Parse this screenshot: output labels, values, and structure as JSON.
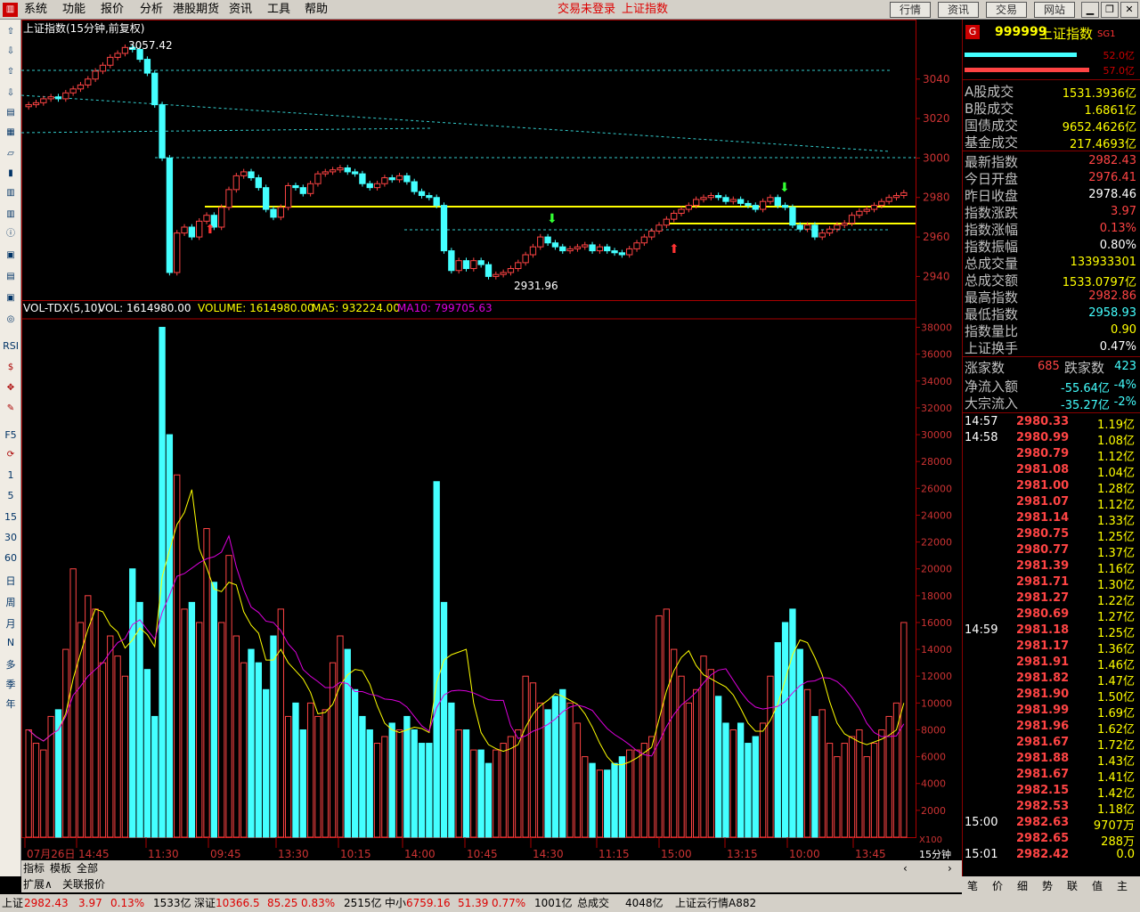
{
  "menubar": {
    "items": [
      "系统",
      "功能",
      "报价",
      "分析",
      "港股期货",
      "资讯",
      "工具",
      "帮助"
    ],
    "center1": "交易未登录",
    "center2": "上证指数",
    "buttons": [
      "行情",
      "资讯",
      "交易",
      "网站"
    ]
  },
  "chart": {
    "title": "上证指数(15分钟,前复权)",
    "high_label": "3057.42",
    "low_label": "2931.96",
    "vol_header": {
      "name": "VOL-TDX(5,10)",
      "vol": "VOL: 1614980.00",
      "volume": "VOLUME: 1614980.00",
      "ma5": "MA5: 932224.00",
      "ma10": "MA10: 799705.63"
    },
    "price_ticks": [
      "3040",
      "3020",
      "3000",
      "2980",
      "2960",
      "2940"
    ],
    "vol_ticks": [
      "38000",
      "36000",
      "34000",
      "32000",
      "30000",
      "28000",
      "26000",
      "24000",
      "22000",
      "20000",
      "18000",
      "16000",
      "14000",
      "12000",
      "10000",
      "8000",
      "6000",
      "4000",
      "2000"
    ],
    "time_ticks": [
      "07月26日",
      "14:45",
      "11:30",
      "09:45",
      "13:30",
      "10:15",
      "14:00",
      "10:45",
      "14:30",
      "11:15",
      "15:00",
      "13:15",
      "10:00",
      "13:45"
    ],
    "x100": "X100",
    "period": "15分钟"
  },
  "chart_data": {
    "type": "candlestick",
    "title": "上证指数(15分钟,前复权)",
    "y_range": [
      2928,
      3062
    ],
    "vol_range": [
      0,
      38500
    ],
    "closes": [
      3027,
      3028,
      3030,
      3031,
      3030,
      3033,
      3035,
      3037,
      3040,
      3044,
      3047,
      3051,
      3053,
      3056,
      3055,
      3050,
      3043,
      3027,
      3000,
      2942,
      2962,
      2965,
      2960,
      2968,
      2971,
      2965,
      2975,
      2984,
      2991,
      2993,
      2990,
      2985,
      2974,
      2970,
      2975,
      2986,
      2985,
      2982,
      2987,
      2992,
      2993,
      2994,
      2995,
      2993,
      2992,
      2987,
      2985,
      2987,
      2990,
      2989,
      2991,
      2988,
      2983,
      2981,
      2980,
      2976,
      2953,
      2943,
      2948,
      2944,
      2948,
      2946,
      2940,
      2941,
      2942,
      2944,
      2947,
      2951,
      2955,
      2960,
      2957,
      2955,
      2953,
      2954,
      2955,
      2956,
      2953,
      2955,
      2953,
      2952,
      2951,
      2954,
      2957,
      2960,
      2963,
      2966,
      2969,
      2972,
      2974,
      2976,
      2979,
      2980,
      2981,
      2980,
      2978,
      2979,
      2977,
      2976,
      2974,
      2978,
      2980,
      2976,
      2975,
      2966,
      2964,
      2966,
      2960,
      2962,
      2964,
      2966,
      2967,
      2971,
      2973,
      2974,
      2976,
      2978,
      2980,
      2981,
      2982.43
    ],
    "volumes": [
      8000,
      7000,
      6500,
      9000,
      9500,
      14000,
      20000,
      16000,
      18000,
      17000,
      13000,
      15000,
      13500,
      12000,
      20000,
      17500,
      12500,
      9000,
      38000,
      30000,
      27000,
      17000,
      17500,
      16000,
      23000,
      19000,
      16000,
      21000,
      15000,
      13000,
      14000,
      13000,
      11000,
      15000,
      17000,
      9000,
      10000,
      8000,
      10000,
      9000,
      9500,
      13000,
      15000,
      14000,
      11000,
      9000,
      8000,
      7000,
      7500,
      8500,
      8000,
      9000,
      8000,
      7000,
      7000,
      26500,
      17500,
      10000,
      8000,
      8000,
      6500,
      6500,
      5500,
      6500,
      7000,
      7500,
      8000,
      12000,
      11500,
      10000,
      9500,
      10500,
      11000,
      10000,
      8500,
      6000,
      5500,
      5000,
      5000,
      5500,
      6000,
      6500,
      6500,
      7000,
      7500,
      16500,
      17000,
      14000,
      12000,
      10000,
      11000,
      13500,
      12500,
      10500,
      8500,
      8000,
      8500,
      7000,
      7500,
      8500,
      12000,
      14500,
      16000,
      17000,
      14000,
      11000,
      9000,
      9500,
      7000,
      6000,
      7000,
      7500,
      8000,
      6000,
      7000,
      8000,
      9000,
      10000,
      16000
    ]
  },
  "right_panel": {
    "g": "G",
    "code": "999999",
    "name": "上证指数",
    "sg": "SG1",
    "bar1": "52.0亿",
    "bar2": "57.0亿",
    "rows1": [
      [
        "A股成交",
        "1531.3936亿",
        "#ff0"
      ],
      [
        "B股成交",
        "1.6861亿",
        "#ff0"
      ],
      [
        "国债成交",
        "9652.4626亿",
        "#ff0"
      ],
      [
        "基金成交",
        "217.4693亿",
        "#ff0"
      ]
    ],
    "rows2": [
      [
        "最新指数",
        "2982.43",
        "#f44"
      ],
      [
        "今日开盘",
        "2976.41",
        "#f44"
      ],
      [
        "昨日收盘",
        "2978.46",
        "#fff"
      ],
      [
        "指数涨跌",
        "3.97",
        "#f44"
      ],
      [
        "指数涨幅",
        "0.13%",
        "#f44"
      ],
      [
        "指数振幅",
        "0.80%",
        "#fff"
      ],
      [
        "总成交量",
        "133933301",
        "#ff0"
      ],
      [
        "总成交额",
        "1533.0797亿",
        "#ff0"
      ],
      [
        "最高指数",
        "2982.86",
        "#f44"
      ],
      [
        "最低指数",
        "2958.93",
        "#4ff"
      ],
      [
        "指数量比",
        "0.90",
        "#ff0"
      ],
      [
        "上证换手",
        "0.47%",
        "#fff"
      ]
    ],
    "up_label": "涨家数",
    "up_val": "685",
    "down_label": "跌家数",
    "down_val": "423",
    "rows3": [
      [
        "净流入额",
        "-55.64亿",
        "-4%"
      ],
      [
        "大宗流入",
        "-35.27亿",
        "-2%"
      ]
    ],
    "ticks": [
      [
        "14:57",
        "2980.33",
        "1.19亿"
      ],
      [
        "14:58",
        "2980.99",
        "1.08亿"
      ],
      [
        "",
        "2980.79",
        "1.12亿"
      ],
      [
        "",
        "2981.08",
        "1.04亿"
      ],
      [
        "",
        "2981.00",
        "1.28亿"
      ],
      [
        "",
        "2981.07",
        "1.12亿"
      ],
      [
        "",
        "2981.14",
        "1.33亿"
      ],
      [
        "",
        "2980.75",
        "1.25亿"
      ],
      [
        "",
        "2980.77",
        "1.37亿"
      ],
      [
        "",
        "2981.39",
        "1.16亿"
      ],
      [
        "",
        "2981.71",
        "1.30亿"
      ],
      [
        "",
        "2981.27",
        "1.22亿"
      ],
      [
        "",
        "2980.69",
        "1.27亿"
      ],
      [
        "14:59",
        "2981.18",
        "1.25亿"
      ],
      [
        "",
        "2981.17",
        "1.36亿"
      ],
      [
        "",
        "2981.91",
        "1.46亿"
      ],
      [
        "",
        "2981.82",
        "1.47亿"
      ],
      [
        "",
        "2981.90",
        "1.50亿"
      ],
      [
        "",
        "2981.99",
        "1.69亿"
      ],
      [
        "",
        "2981.96",
        "1.62亿"
      ],
      [
        "",
        "2981.67",
        "1.72亿"
      ],
      [
        "",
        "2981.88",
        "1.43亿"
      ],
      [
        "",
        "2981.67",
        "1.41亿"
      ],
      [
        "",
        "2982.15",
        "1.42亿"
      ],
      [
        "",
        "2982.53",
        "1.18亿"
      ],
      [
        "15:00",
        "2982.63",
        "9707万"
      ],
      [
        "",
        "2982.65",
        "288万"
      ],
      [
        "15:01",
        "2982.42",
        "0.0"
      ]
    ],
    "bottom": [
      "笔",
      "价",
      "细",
      "势",
      "联",
      "值",
      "主"
    ]
  },
  "left_toolbar": {
    "labels": [
      "RSI",
      "F5",
      "1",
      "5",
      "15",
      "30",
      "60",
      "日",
      "周",
      "月",
      "N",
      "多",
      "季",
      "年"
    ]
  },
  "bottom_tabs": {
    "row1": [
      "指标",
      "模板",
      "全部"
    ],
    "row2": [
      "扩展∧",
      "关联报价"
    ]
  },
  "statusbar": {
    "sh_name": "上证",
    "sh_val": "2982.43",
    "sh_chg": "3.97",
    "sh_pct": "0.13%",
    "sh_amt": "1533亿",
    "sz_name": "深证",
    "sz_val": "10366.5",
    "sz_chg": "85.25",
    "sz_pct": "0.83%",
    "sz_amt": "2515亿",
    "zx_name": "中小",
    "zx_val": "6759.16",
    "zx_chg": "51.39",
    "zx_pct": "0.77%",
    "zx_amt": "1001亿",
    "total_label": "总成交",
    "total_val": "4048亿",
    "cloud": "上证云行情A882"
  }
}
